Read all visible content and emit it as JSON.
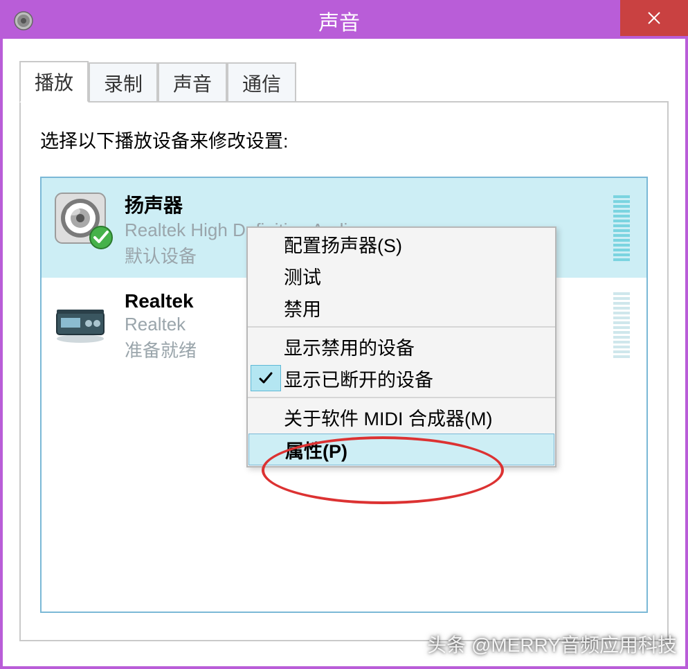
{
  "window": {
    "title": "声音",
    "watermark": "头条 @MERRY音频应用科技"
  },
  "tabs": {
    "items": [
      {
        "label": "播放",
        "active": true
      },
      {
        "label": "录制",
        "active": false
      },
      {
        "label": "声音",
        "active": false
      },
      {
        "label": "通信",
        "active": false
      }
    ]
  },
  "playback": {
    "instruction": "选择以下播放设备来修改设置:",
    "devices": [
      {
        "name": "扬声器",
        "subtitle": "Realtek High Definition Audio",
        "status": "默认设备",
        "selected": true,
        "default": true,
        "meter_dim": false
      },
      {
        "name": "Realtek",
        "subtitle": "Realtek",
        "status": "准备就绪",
        "selected": false,
        "default": false,
        "meter_dim": true
      }
    ]
  },
  "context_menu": {
    "items": [
      {
        "label": "配置扬声器(S)",
        "checked": false
      },
      {
        "label": "测试",
        "checked": false
      },
      {
        "label": "禁用",
        "checked": false
      },
      {
        "label": "显示禁用的设备",
        "checked": false
      },
      {
        "label": "显示已断开的设备",
        "checked": true
      },
      {
        "label": "关于软件 MIDI 合成器(M)",
        "checked": false
      },
      {
        "label": "属性(P)",
        "checked": false,
        "hover": true
      }
    ]
  }
}
